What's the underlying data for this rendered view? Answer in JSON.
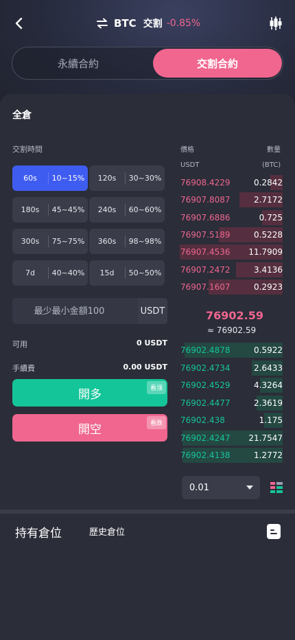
{
  "header": {
    "symbol": "BTC",
    "contract_type": "交割",
    "change": "-0.85%"
  },
  "mode_tabs": {
    "perpetual": "永續合約",
    "delivery": "交割合約"
  },
  "position_mode": "全倉",
  "delivery_time_label": "交割時間",
  "durations": [
    {
      "duration": "60s",
      "range": "10~15%",
      "active": true
    },
    {
      "duration": "120s",
      "range": "30~30%",
      "active": false
    },
    {
      "duration": "180s",
      "range": "45~45%",
      "active": false
    },
    {
      "duration": "240s",
      "range": "60~60%",
      "active": false
    },
    {
      "duration": "300s",
      "range": "75~75%",
      "active": false
    },
    {
      "duration": "360s",
      "range": "98~98%",
      "active": false
    },
    {
      "duration": "7d",
      "range": "40~40%",
      "active": false
    },
    {
      "duration": "15d",
      "range": "50~50%",
      "active": false
    }
  ],
  "amount": {
    "placeholder": "最少最小金額100",
    "unit": "USDT"
  },
  "available": {
    "label": "可用",
    "value": "0 USDT"
  },
  "fee": {
    "label": "手續費",
    "value": "0.00 USDT"
  },
  "actions": {
    "long_label": "開多",
    "long_tag": "看漲",
    "short_label": "開空",
    "short_tag": "看跌"
  },
  "orderbook": {
    "price_label": "價格",
    "qty_label": "數量",
    "price_unit": "USDT",
    "qty_unit": "(BTC)",
    "asks": [
      {
        "price": "76908.4229",
        "qty": "0.2842",
        "depth": 0.12
      },
      {
        "price": "76907.8087",
        "qty": "2.7172",
        "depth": 0.42
      },
      {
        "price": "76907.6886",
        "qty": "0.725",
        "depth": 0.2
      },
      {
        "price": "76907.5189",
        "qty": "0.5228",
        "depth": 0.62
      },
      {
        "price": "76907.4536",
        "qty": "11.7909",
        "depth": 1.0
      },
      {
        "price": "76907.2472",
        "qty": "3.4136",
        "depth": 0.45
      },
      {
        "price": "76907.1607",
        "qty": "0.2923",
        "depth": 0.72
      }
    ],
    "mid_price": "76902.59",
    "mid_ref": "≈ 76902.59",
    "bids": [
      {
        "price": "76902.4878",
        "qty": "0.5922",
        "depth": 0.95
      },
      {
        "price": "76902.4734",
        "qty": "2.6433",
        "depth": 0.3
      },
      {
        "price": "76902.4529",
        "qty": "4.3264",
        "depth": 0.22
      },
      {
        "price": "76902.4477",
        "qty": "2.3619",
        "depth": 0.25
      },
      {
        "price": "76902.438",
        "qty": "1.175",
        "depth": 0.18
      },
      {
        "price": "76902.4247",
        "qty": "21.7547",
        "depth": 0.97
      },
      {
        "price": "76902.4138",
        "qty": "1.2772",
        "depth": 0.97
      }
    ]
  },
  "quantity_step": "0.01",
  "bottom_tabs": {
    "holdings": "持有倉位",
    "history": "歷史倉位"
  },
  "colors": {
    "accent_pink": "#f0668f",
    "accent_green": "#15c59a",
    "accent_blue": "#3f5cf0"
  }
}
